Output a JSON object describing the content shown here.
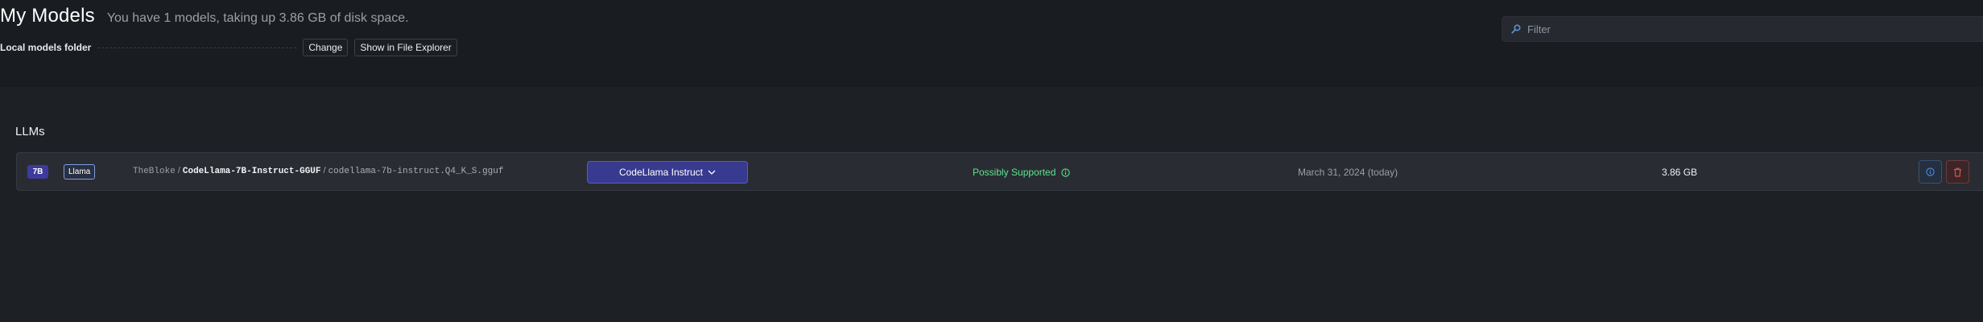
{
  "header": {
    "title": "My Models",
    "subtitle": "You have 1 models, taking up 3.86 GB of disk space.",
    "folder_label": "Local models folder",
    "change_label": "Change",
    "show_in_explorer_label": "Show in File Explorer"
  },
  "filter": {
    "placeholder": "Filter",
    "icon": "search-icon"
  },
  "section": {
    "title": "LLMs"
  },
  "models": [
    {
      "size_badge": "7B",
      "arch_badge": "Llama",
      "owner": "TheBloke",
      "separator": "/",
      "repo": "CodeLlama-7B-Instruct-GGUF",
      "file": "codellama-7b-instruct.Q4_K_S.gguf",
      "preset": "CodeLlama Instruct",
      "support_status": "Possibly Supported",
      "date": "March 31, 2024 (today)",
      "size": "3.86 GB"
    }
  ],
  "colors": {
    "accent": "#383a8f",
    "supported": "#5ee38c",
    "delete": "#e0504f",
    "info": "#4f8fe0"
  }
}
